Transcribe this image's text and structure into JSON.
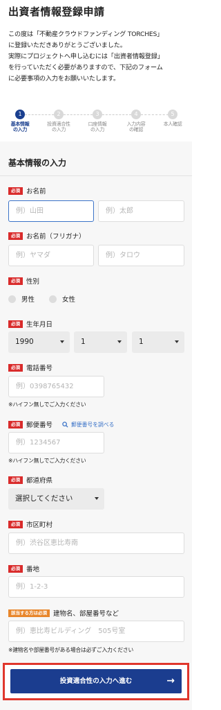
{
  "header": {
    "title": "出資者情報登録申請",
    "intro_lines": [
      "この度は「不動産クラウドファンディング TORCHES」",
      "に登録いただきありがとうございました。",
      "実際にプロジェクトへ申し込むには「出資者情報登録」",
      "を行っていただく必要がありますので、下記のフォーム",
      "に必要事項の入力をお願いいたします。"
    ]
  },
  "steps": [
    {
      "num": "1",
      "line1": "基本情報",
      "line2": "の入力",
      "active": true
    },
    {
      "num": "2",
      "line1": "投資適合性",
      "line2": "の入力",
      "active": false
    },
    {
      "num": "3",
      "line1": "口座情報",
      "line2": "の入力",
      "active": false
    },
    {
      "num": "4",
      "line1": "入力内容",
      "line2": "の確認",
      "active": false
    },
    {
      "num": "5",
      "line1": "本人確認",
      "line2": "",
      "active": false
    }
  ],
  "form": {
    "section_title": "基本情報の入力",
    "required_badge": "必須",
    "building_badge": "該当する方は必須",
    "name": {
      "label": "お名前",
      "last_placeholder": "例）山田",
      "first_placeholder": "例）太郎"
    },
    "name_kana": {
      "label": "お名前（フリガナ）",
      "last_placeholder": "例）ヤマダ",
      "first_placeholder": "例）タロウ"
    },
    "gender": {
      "label": "性別",
      "male": "男性",
      "female": "女性"
    },
    "birthdate": {
      "label": "生年月日",
      "year": "1990",
      "month": "1",
      "day": "1"
    },
    "phone": {
      "label": "電話番号",
      "placeholder": "例）0398765432",
      "note": "※ハイフン無しでご入力ください"
    },
    "zip": {
      "label": "郵便番号",
      "search_link": "郵便番号を調べる",
      "placeholder": "例）1234567",
      "note": "※ハイフン無しでご入力ください"
    },
    "prefecture": {
      "label": "都道府県",
      "value": "選択してください"
    },
    "city": {
      "label": "市区町村",
      "placeholder": "例）渋谷区恵比寿南"
    },
    "street": {
      "label": "番地",
      "placeholder": "例）1-2-3"
    },
    "building": {
      "label": "建物名、部屋番号など",
      "placeholder": "例）恵比寿ビルディング　505号室",
      "note": "※建物名や部屋番号がある場合は必ずご入力ください"
    },
    "submit_label": "投資適合性の入力へ進む",
    "submit_arrow": "→"
  },
  "colors": {
    "primary": "#1b3d8f",
    "required": "#d92b2b",
    "optional_required": "#e8862b",
    "link": "#3b73c8",
    "highlight_outline": "#e0362c"
  }
}
